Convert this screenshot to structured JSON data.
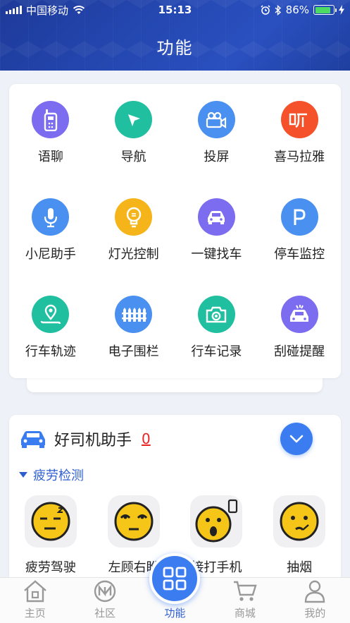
{
  "status_bar": {
    "carrier": "中国移动",
    "time": "15:13",
    "battery": "86%",
    "battery_level": 0.86
  },
  "header": {
    "title": "功能"
  },
  "functions": [
    {
      "label": "语聊",
      "icon": "walkie-talkie-icon",
      "color": "#7b6cf0"
    },
    {
      "label": "导航",
      "icon": "navigation-arrow-icon",
      "color": "#1fbfa0"
    },
    {
      "label": "投屏",
      "icon": "video-camera-icon",
      "color": "#4a90f0"
    },
    {
      "label": "喜马拉雅",
      "icon": "ximalaya-listen-icon",
      "color": "#f5522b"
    },
    {
      "label": "小尼助手",
      "icon": "microphone-icon",
      "color": "#4a90f0"
    },
    {
      "label": "灯光控制",
      "icon": "light-bulb-icon",
      "color": "#f5b51a"
    },
    {
      "label": "一键找车",
      "icon": "car-icon",
      "color": "#7b6cf0"
    },
    {
      "label": "停车监控",
      "icon": "parking-icon",
      "color": "#4a90f0"
    },
    {
      "label": "行车轨迹",
      "icon": "location-track-icon",
      "color": "#1fbfa0"
    },
    {
      "label": "电子围栏",
      "icon": "fence-icon",
      "color": "#4a90f0"
    },
    {
      "label": "行车记录",
      "icon": "camera-icon",
      "color": "#1fbfa0"
    },
    {
      "label": "刮碰提醒",
      "icon": "car-collision-icon",
      "color": "#7b6cf0"
    }
  ],
  "assistant": {
    "title": "好司机助手",
    "count": "0",
    "section": "疲劳检测",
    "items": [
      {
        "label": "疲劳驾驶",
        "icon": "sleepy-face-icon"
      },
      {
        "label": "左顾右盼",
        "icon": "looking-around-face-icon"
      },
      {
        "label": "接打手机",
        "icon": "phone-call-face-icon"
      },
      {
        "label": "抽烟",
        "icon": "smoking-face-icon"
      }
    ]
  },
  "tabs": [
    {
      "label": "主页",
      "icon": "home-icon"
    },
    {
      "label": "社区",
      "icon": "community-icon"
    },
    {
      "label": "功能",
      "icon": "grid-icon"
    },
    {
      "label": "商城",
      "icon": "cart-icon"
    },
    {
      "label": "我的",
      "icon": "person-icon"
    }
  ],
  "colors": {
    "accent": "#3b7df0",
    "header": "#2447b0",
    "alert": "#e82424",
    "battery": "#4cd964"
  }
}
